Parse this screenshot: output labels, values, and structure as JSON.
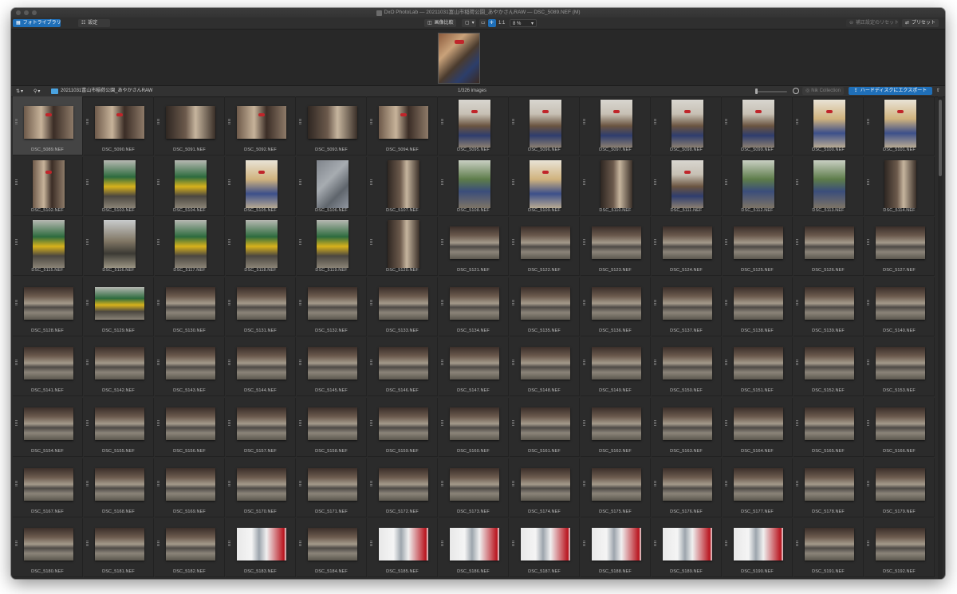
{
  "window": {
    "title": "DxO PhotoLab — 20211031富山市稲荷公園_あやかさんRAW — DSC_5089.NEF (M)"
  },
  "toolbar": {
    "library_label": "フォトライブラリ",
    "customize_label": "設定",
    "compare_label": "画像比較",
    "one_to_one": "1:1",
    "zoom": "8 %",
    "reset_label": "補正設定のリセット",
    "preset_label": "プリセット"
  },
  "browser": {
    "folder": "20211031富山市稲荷公園_あやかさんRAW",
    "count": "1/326 images",
    "collection_label": "Nik Collection",
    "export_label": "ハードディスクにエクスポート"
  },
  "colors": {
    "accent": "#1f6fb8",
    "window_bg": "#2b2b2b"
  },
  "photos": [
    {
      "name": "DSC_5089.NEF",
      "orientation": "landscape",
      "kind": "bench-bow",
      "selected": true
    },
    {
      "name": "DSC_5090.NEF",
      "orientation": "landscape",
      "kind": "bench-bow"
    },
    {
      "name": "DSC_5091.NEF",
      "orientation": "landscape",
      "kind": "pillar"
    },
    {
      "name": "DSC_5092.NEF",
      "orientation": "landscape",
      "kind": "bench-bow"
    },
    {
      "name": "DSC_5093.NEF",
      "orientation": "landscape",
      "kind": "pillar"
    },
    {
      "name": "DSC_5094.NEF",
      "orientation": "landscape",
      "kind": "bench-bow"
    },
    {
      "name": "DSC_5095.NEF",
      "orientation": "portrait",
      "kind": "broom"
    },
    {
      "name": "DSC_5096.NEF",
      "orientation": "portrait",
      "kind": "broom"
    },
    {
      "name": "DSC_5097.NEF",
      "orientation": "portrait",
      "kind": "broom"
    },
    {
      "name": "DSC_5098.NEF",
      "orientation": "portrait",
      "kind": "broom"
    },
    {
      "name": "DSC_5099.NEF",
      "orientation": "portrait",
      "kind": "broom"
    },
    {
      "name": "DSC_5100.NEF",
      "orientation": "portrait",
      "kind": "bright"
    },
    {
      "name": "DSC_5101.NEF",
      "orientation": "portrait",
      "kind": "bright"
    },
    {
      "name": "DSC_5102.NEF",
      "orientation": "portrait",
      "kind": "bench-bow"
    },
    {
      "name": "DSC_5103.NEF",
      "orientation": "portrait",
      "kind": "train"
    },
    {
      "name": "DSC_5104.NEF",
      "orientation": "portrait",
      "kind": "train"
    },
    {
      "name": "DSC_5105.NEF",
      "orientation": "portrait",
      "kind": "bright"
    },
    {
      "name": "DSC_5106.NEF",
      "orientation": "portrait",
      "kind": "concrete"
    },
    {
      "name": "DSC_5107.NEF",
      "orientation": "portrait",
      "kind": "pillar"
    },
    {
      "name": "DSC_5108.NEF",
      "orientation": "portrait",
      "kind": "green"
    },
    {
      "name": "DSC_5109.NEF",
      "orientation": "portrait",
      "kind": "bright"
    },
    {
      "name": "DSC_5110.NEF",
      "orientation": "portrait",
      "kind": "pillar"
    },
    {
      "name": "DSC_5111.NEF",
      "orientation": "portrait",
      "kind": "broom"
    },
    {
      "name": "DSC_5112.NEF",
      "orientation": "portrait",
      "kind": "green"
    },
    {
      "name": "DSC_5113.NEF",
      "orientation": "portrait",
      "kind": "green"
    },
    {
      "name": "DSC_5114.NEF",
      "orientation": "portrait",
      "kind": "pillar"
    },
    {
      "name": "DSC_5115.NEF",
      "orientation": "portrait",
      "kind": "train"
    },
    {
      "name": "DSC_5116.NEF",
      "orientation": "portrait",
      "kind": "platform"
    },
    {
      "name": "DSC_5117.NEF",
      "orientation": "portrait",
      "kind": "train"
    },
    {
      "name": "DSC_5118.NEF",
      "orientation": "portrait",
      "kind": "train"
    },
    {
      "name": "DSC_5119.NEF",
      "orientation": "portrait",
      "kind": "train"
    },
    {
      "name": "DSC_5120.NEF",
      "orientation": "portrait",
      "kind": "pillar"
    },
    {
      "name": "DSC_5121.NEF",
      "orientation": "landscape",
      "kind": "station"
    },
    {
      "name": "DSC_5122.NEF",
      "orientation": "landscape",
      "kind": "station"
    },
    {
      "name": "DSC_5123.NEF",
      "orientation": "landscape",
      "kind": "station"
    },
    {
      "name": "DSC_5124.NEF",
      "orientation": "landscape",
      "kind": "station"
    },
    {
      "name": "DSC_5125.NEF",
      "orientation": "landscape",
      "kind": "station"
    },
    {
      "name": "DSC_5126.NEF",
      "orientation": "landscape",
      "kind": "station"
    },
    {
      "name": "DSC_5127.NEF",
      "orientation": "landscape",
      "kind": "station"
    },
    {
      "name": "DSC_5128.NEF",
      "orientation": "landscape",
      "kind": "station"
    },
    {
      "name": "DSC_5129.NEF",
      "orientation": "landscape",
      "kind": "train"
    },
    {
      "name": "DSC_5130.NEF",
      "orientation": "landscape",
      "kind": "station"
    },
    {
      "name": "DSC_5131.NEF",
      "orientation": "landscape",
      "kind": "station"
    },
    {
      "name": "DSC_5132.NEF",
      "orientation": "landscape",
      "kind": "station"
    },
    {
      "name": "DSC_5133.NEF",
      "orientation": "landscape",
      "kind": "station"
    },
    {
      "name": "DSC_5134.NEF",
      "orientation": "landscape",
      "kind": "station"
    },
    {
      "name": "DSC_5135.NEF",
      "orientation": "landscape",
      "kind": "station"
    },
    {
      "name": "DSC_5136.NEF",
      "orientation": "landscape",
      "kind": "station"
    },
    {
      "name": "DSC_5137.NEF",
      "orientation": "landscape",
      "kind": "station"
    },
    {
      "name": "DSC_5138.NEF",
      "orientation": "landscape",
      "kind": "station"
    },
    {
      "name": "DSC_5139.NEF",
      "orientation": "landscape",
      "kind": "station"
    },
    {
      "name": "DSC_5140.NEF",
      "orientation": "landscape",
      "kind": "station"
    },
    {
      "name": "DSC_5141.NEF",
      "orientation": "landscape",
      "kind": "station"
    },
    {
      "name": "DSC_5142.NEF",
      "orientation": "landscape",
      "kind": "station"
    },
    {
      "name": "DSC_5143.NEF",
      "orientation": "landscape",
      "kind": "station"
    },
    {
      "name": "DSC_5144.NEF",
      "orientation": "landscape",
      "kind": "station"
    },
    {
      "name": "DSC_5145.NEF",
      "orientation": "landscape",
      "kind": "station"
    },
    {
      "name": "DSC_5146.NEF",
      "orientation": "landscape",
      "kind": "station"
    },
    {
      "name": "DSC_5147.NEF",
      "orientation": "landscape",
      "kind": "station"
    },
    {
      "name": "DSC_5148.NEF",
      "orientation": "landscape",
      "kind": "station"
    },
    {
      "name": "DSC_5149.NEF",
      "orientation": "landscape",
      "kind": "station"
    },
    {
      "name": "DSC_5150.NEF",
      "orientation": "landscape",
      "kind": "station"
    },
    {
      "name": "DSC_5151.NEF",
      "orientation": "landscape",
      "kind": "station"
    },
    {
      "name": "DSC_5152.NEF",
      "orientation": "landscape",
      "kind": "station"
    },
    {
      "name": "DSC_5153.NEF",
      "orientation": "landscape",
      "kind": "station"
    },
    {
      "name": "DSC_5154.NEF",
      "orientation": "landscape",
      "kind": "station"
    },
    {
      "name": "DSC_5155.NEF",
      "orientation": "landscape",
      "kind": "station"
    },
    {
      "name": "DSC_5156.NEF",
      "orientation": "landscape",
      "kind": "station"
    },
    {
      "name": "DSC_5157.NEF",
      "orientation": "landscape",
      "kind": "station"
    },
    {
      "name": "DSC_5158.NEF",
      "orientation": "landscape",
      "kind": "station"
    },
    {
      "name": "DSC_5159.NEF",
      "orientation": "landscape",
      "kind": "station"
    },
    {
      "name": "DSC_5160.NEF",
      "orientation": "landscape",
      "kind": "station"
    },
    {
      "name": "DSC_5161.NEF",
      "orientation": "landscape",
      "kind": "station"
    },
    {
      "name": "DSC_5162.NEF",
      "orientation": "landscape",
      "kind": "station"
    },
    {
      "name": "DSC_5163.NEF",
      "orientation": "landscape",
      "kind": "station"
    },
    {
      "name": "DSC_5164.NEF",
      "orientation": "landscape",
      "kind": "station"
    },
    {
      "name": "DSC_5165.NEF",
      "orientation": "landscape",
      "kind": "station"
    },
    {
      "name": "DSC_5166.NEF",
      "orientation": "landscape",
      "kind": "station"
    },
    {
      "name": "DSC_5167.NEF",
      "orientation": "landscape",
      "kind": "station"
    },
    {
      "name": "DSC_5168.NEF",
      "orientation": "landscape",
      "kind": "station"
    },
    {
      "name": "DSC_5169.NEF",
      "orientation": "landscape",
      "kind": "station"
    },
    {
      "name": "DSC_5170.NEF",
      "orientation": "landscape",
      "kind": "station"
    },
    {
      "name": "DSC_5171.NEF",
      "orientation": "landscape",
      "kind": "station"
    },
    {
      "name": "DSC_5172.NEF",
      "orientation": "landscape",
      "kind": "station"
    },
    {
      "name": "DSC_5173.NEF",
      "orientation": "landscape",
      "kind": "station"
    },
    {
      "name": "DSC_5174.NEF",
      "orientation": "landscape",
      "kind": "station"
    },
    {
      "name": "DSC_5175.NEF",
      "orientation": "landscape",
      "kind": "station"
    },
    {
      "name": "DSC_5176.NEF",
      "orientation": "landscape",
      "kind": "station"
    },
    {
      "name": "DSC_5177.NEF",
      "orientation": "landscape",
      "kind": "station"
    },
    {
      "name": "DSC_5178.NEF",
      "orientation": "landscape",
      "kind": "station"
    },
    {
      "name": "DSC_5179.NEF",
      "orientation": "landscape",
      "kind": "station"
    },
    {
      "name": "DSC_5180.NEF",
      "orientation": "landscape",
      "kind": "station"
    },
    {
      "name": "DSC_5181.NEF",
      "orientation": "landscape",
      "kind": "station"
    },
    {
      "name": "DSC_5182.NEF",
      "orientation": "landscape",
      "kind": "station"
    },
    {
      "name": "DSC_5183.NEF",
      "orientation": "landscape",
      "kind": "window"
    },
    {
      "name": "DSC_5184.NEF",
      "orientation": "landscape",
      "kind": "station"
    },
    {
      "name": "DSC_5185.NEF",
      "orientation": "landscape",
      "kind": "window"
    },
    {
      "name": "DSC_5186.NEF",
      "orientation": "landscape",
      "kind": "window"
    },
    {
      "name": "DSC_5187.NEF",
      "orientation": "landscape",
      "kind": "window"
    },
    {
      "name": "DSC_5188.NEF",
      "orientation": "landscape",
      "kind": "window"
    },
    {
      "name": "DSC_5189.NEF",
      "orientation": "landscape",
      "kind": "window"
    },
    {
      "name": "DSC_5190.NEF",
      "orientation": "landscape",
      "kind": "window"
    },
    {
      "name": "DSC_5191.NEF",
      "orientation": "landscape",
      "kind": "station"
    },
    {
      "name": "DSC_5192.NEF",
      "orientation": "landscape",
      "kind": "station"
    }
  ]
}
